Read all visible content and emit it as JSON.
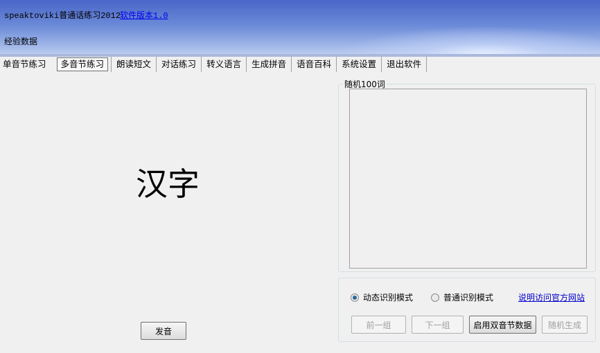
{
  "header": {
    "title": "speaktoviki普通话练习2012",
    "version_link": "软件版本1.0",
    "experience": "经验数据"
  },
  "tabs": [
    {
      "label": "单音节练习"
    },
    {
      "label": "多音节练习"
    },
    {
      "label": "朗读短文"
    },
    {
      "label": "对话练习"
    },
    {
      "label": "转义语言"
    },
    {
      "label": "生成拼音"
    },
    {
      "label": "语音百科"
    },
    {
      "label": "系统设置"
    },
    {
      "label": "退出软件"
    }
  ],
  "main": {
    "hanzi": "汉字",
    "pronounce_label": "发音"
  },
  "random": {
    "group_label": "随机100词"
  },
  "controls": {
    "mode_dynamic": "动态识别模式",
    "mode_normal": "普通识别模式",
    "selected_mode": "dynamic",
    "help_link": "说明访问官方网站",
    "prev_label": "前一组",
    "next_label": "下一组",
    "enable_label": "启用双音节数据",
    "random_label": "随机生成"
  }
}
